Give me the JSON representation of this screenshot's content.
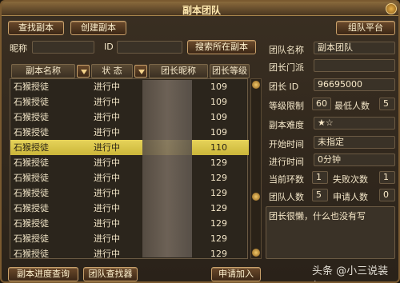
{
  "window": {
    "title": "副本团队"
  },
  "top_buttons": {
    "find_instance": "查找副本",
    "create_instance": "创建副本",
    "group_platform": "组队平台"
  },
  "filters": {
    "nickname_label": "昵称",
    "nickname_value": "",
    "id_label": "ID",
    "id_value": "",
    "search_button": "搜索所在副本"
  },
  "table": {
    "columns": [
      "副本名称",
      "状 态",
      "团长昵称",
      "团长等级"
    ],
    "rows": [
      {
        "name": "石猴授徒",
        "status": "进行中",
        "leader": "",
        "level": "109",
        "selected": false
      },
      {
        "name": "石猴授徒",
        "status": "进行中",
        "leader": "",
        "level": "109",
        "selected": false
      },
      {
        "name": "石猴授徒",
        "status": "进行中",
        "leader": "",
        "level": "109",
        "selected": false
      },
      {
        "name": "石猴授徒",
        "status": "进行中",
        "leader": "",
        "level": "109",
        "selected": false
      },
      {
        "name": "石猴授徒",
        "status": "进行中",
        "leader": "",
        "level": "110",
        "selected": true
      },
      {
        "name": "石猴授徒",
        "status": "进行中",
        "leader": "",
        "level": "129",
        "selected": false
      },
      {
        "name": "石猴授徒",
        "status": "进行中",
        "leader": "",
        "level": "129",
        "selected": false
      },
      {
        "name": "石猴授徒",
        "status": "进行中",
        "leader": "",
        "level": "129",
        "selected": false
      },
      {
        "name": "石猴授徒",
        "status": "进行中",
        "leader": "",
        "level": "129",
        "selected": false
      },
      {
        "name": "石猴授徒",
        "status": "进行中",
        "leader": "",
        "level": "129",
        "selected": false
      },
      {
        "name": "石猴授徒",
        "status": "进行中",
        "leader": "",
        "level": "129",
        "selected": false
      },
      {
        "name": "石猴授徒",
        "status": "进行中",
        "leader": "",
        "level": "129",
        "selected": false
      }
    ]
  },
  "details": {
    "team_name_label": "团队名称",
    "team_name_value": "副本团队",
    "sect_label": "团长门派",
    "sect_value": "",
    "leader_id_label": "团长 ID",
    "leader_id_value": "96695000",
    "level_limit_label": "等级限制",
    "level_limit_value": "60",
    "min_players_label": "最低人数",
    "min_players_value": "5",
    "difficulty_label": "副本难度",
    "difficulty_value": "★☆",
    "start_time_label": "开始时间",
    "start_time_value": "未指定",
    "elapsed_label": "进行时间",
    "elapsed_value": "0分钟",
    "round_label": "当前环数",
    "round_value": "1",
    "fail_label": "失败次数",
    "fail_value": "1",
    "team_size_label": "团队人数",
    "team_size_value": "5",
    "apply_label": "申请人数",
    "apply_value": "0",
    "message": "团长很懒，什么也没有写"
  },
  "bottom_buttons": {
    "progress_query": "副本进度查询",
    "team_finder": "团队查找器",
    "apply_join": "申请加入"
  },
  "watermark": "头条 @小三说装幻",
  "colors": {
    "highlight": "#e6d35a",
    "frame": "#7a5a30"
  }
}
